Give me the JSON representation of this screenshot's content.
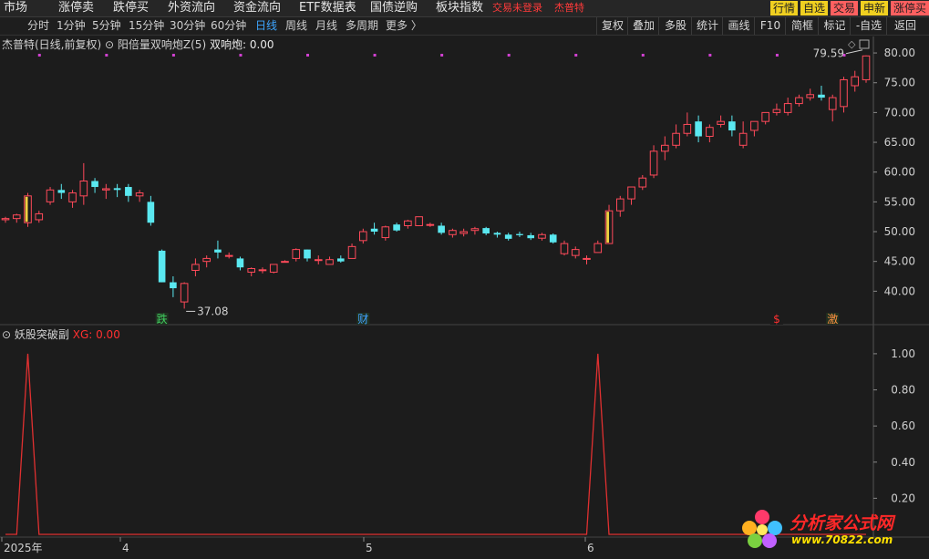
{
  "menu": {
    "items": [
      "市场",
      "涨停卖",
      "跌停买",
      "外资流向",
      "资金流向",
      "ETF数据表",
      "国债逆购",
      "板块指数"
    ],
    "status": "交易未登录",
    "user": "杰普特",
    "right_buttons": [
      {
        "label": "行情",
        "color": "#f0d020"
      },
      {
        "label": "自选",
        "color": "#f0d020"
      },
      {
        "label": "交易",
        "color": "#ff6060"
      },
      {
        "label": "申新",
        "color": "#f0d020"
      },
      {
        "label": "涨停买",
        "color": "#ff6060"
      }
    ]
  },
  "periods": {
    "items": [
      "分时",
      "1分钟",
      "5分钟",
      "15分钟",
      "30分钟",
      "60分钟",
      "日线",
      "周线",
      "月线",
      "多周期",
      "更多 〉"
    ],
    "active": "日线",
    "right_buttons": [
      "复权",
      "叠加",
      "多股",
      "统计",
      "画线",
      "F10",
      "简框",
      "标记",
      "-自选",
      "返回"
    ]
  },
  "main_chart": {
    "stock_title": "杰普特(日线,前复权)",
    "indicator": "阳倍量双响炮Z(5)",
    "indicator_value_label": "双响炮: 0.00",
    "high_label": "79.59",
    "low_label": "37.08",
    "markers": [
      "跌",
      "财",
      "$",
      "激"
    ]
  },
  "sub_chart": {
    "title": "妖股突破副",
    "value_label": "XG: 0.00"
  },
  "x_axis": [
    "2025年",
    "4",
    "5",
    "6"
  ],
  "watermark": {
    "brand": "分析家公式网",
    "url": "www.70822.com"
  },
  "chart_data": [
    {
      "type": "candlestick",
      "title": "杰普特(日线,前复权)",
      "ylim": [
        35,
        82
      ],
      "y_ticks": [
        40.0,
        45.0,
        50.0,
        55.0,
        60.0,
        65.0,
        70.0,
        75.0,
        80.0
      ],
      "x_labels": [
        "2025年",
        "4",
        "5",
        "6"
      ],
      "ohlc": [
        [
          52.0,
          52.5,
          51.5,
          52.2
        ],
        [
          52.2,
          53.0,
          51.5,
          52.8
        ],
        [
          51.5,
          56.5,
          50.8,
          56.0
        ],
        [
          52.0,
          53.5,
          51.5,
          53.0
        ],
        [
          55.0,
          57.5,
          54.5,
          57.0
        ],
        [
          57.0,
          58.0,
          55.5,
          56.5
        ],
        [
          55.0,
          57.0,
          54.0,
          56.5
        ],
        [
          56.0,
          61.5,
          54.5,
          58.5
        ],
        [
          58.5,
          59.0,
          56.5,
          57.5
        ],
        [
          57.0,
          58.0,
          55.5,
          57.2
        ],
        [
          57.3,
          58.0,
          55.8,
          57.0
        ],
        [
          57.5,
          58.0,
          55.0,
          56.0
        ],
        [
          56.0,
          57.0,
          55.0,
          56.5
        ],
        [
          55.0,
          56.0,
          51.0,
          51.5
        ],
        [
          46.8,
          47.0,
          41.5,
          41.5
        ],
        [
          41.5,
          42.5,
          39.0,
          40.5
        ],
        [
          38.2,
          41.5,
          37.08,
          41.3
        ],
        [
          43.5,
          45.5,
          42.5,
          44.5
        ],
        [
          45.0,
          46.0,
          44.0,
          45.5
        ],
        [
          47.0,
          48.5,
          45.5,
          46.5
        ],
        [
          46.0,
          46.5,
          45.5,
          46.0
        ],
        [
          45.5,
          45.8,
          43.5,
          44.0
        ],
        [
          43.2,
          44.0,
          42.5,
          43.8
        ],
        [
          43.5,
          44.0,
          43.0,
          43.6
        ],
        [
          43.2,
          44.5,
          43.0,
          44.5
        ],
        [
          45.0,
          45.2,
          44.8,
          45.0
        ],
        [
          45.5,
          47.2,
          45.0,
          47.0
        ],
        [
          47.0,
          47.0,
          45.0,
          45.5
        ],
        [
          45.2,
          46.0,
          44.5,
          45.3
        ],
        [
          44.5,
          45.8,
          44.5,
          45.3
        ],
        [
          45.5,
          46.0,
          44.8,
          45.0
        ],
        [
          45.5,
          48.0,
          45.5,
          47.5
        ],
        [
          48.5,
          50.5,
          48.0,
          50.0
        ],
        [
          50.5,
          51.5,
          49.5,
          50.0
        ],
        [
          49.0,
          51.0,
          48.5,
          50.8
        ],
        [
          51.2,
          51.5,
          50.0,
          50.2
        ],
        [
          51.0,
          52.0,
          50.5,
          51.8
        ],
        [
          51.0,
          52.5,
          51.0,
          52.5
        ],
        [
          51.2,
          51.5,
          50.8,
          51.2
        ],
        [
          51.0,
          51.5,
          49.5,
          49.8
        ],
        [
          49.5,
          50.5,
          49.0,
          50.2
        ],
        [
          49.7,
          50.5,
          49.2,
          50.0
        ],
        [
          50.2,
          50.8,
          49.5,
          50.5
        ],
        [
          50.6,
          50.8,
          49.4,
          49.7
        ],
        [
          49.8,
          50.0,
          49.0,
          49.5
        ],
        [
          49.5,
          49.8,
          48.5,
          48.8
        ],
        [
          49.6,
          50.0,
          49.1,
          49.4
        ],
        [
          49.4,
          49.8,
          48.6,
          48.9
        ],
        [
          48.9,
          49.8,
          48.5,
          49.5
        ],
        [
          49.5,
          49.7,
          48.0,
          48.2
        ],
        [
          46.3,
          48.5,
          46.0,
          48.0
        ],
        [
          46.0,
          47.5,
          45.5,
          47.0
        ],
        [
          45.5,
          46.0,
          44.5,
          45.5
        ],
        [
          46.5,
          48.5,
          46.5,
          48.0
        ],
        [
          48.0,
          54.5,
          48.0,
          53.5
        ],
        [
          53.5,
          56.0,
          52.5,
          55.5
        ],
        [
          55.5,
          57.5,
          54.5,
          57.5
        ],
        [
          57.5,
          59.5,
          57.0,
          59.0
        ],
        [
          59.5,
          64.5,
          59.0,
          63.5
        ],
        [
          63.5,
          66.0,
          62.0,
          64.5
        ],
        [
          64.5,
          68.0,
          64.0,
          66.5
        ],
        [
          66.5,
          70.0,
          66.0,
          68.0
        ],
        [
          68.5,
          69.5,
          65.0,
          66.0
        ],
        [
          66.0,
          68.0,
          65.0,
          67.5
        ],
        [
          68.0,
          69.5,
          67.5,
          68.5
        ],
        [
          68.5,
          69.5,
          66.0,
          67.0
        ],
        [
          64.5,
          68.5,
          64.0,
          66.5
        ],
        [
          67.0,
          68.5,
          66.0,
          68.5
        ],
        [
          68.5,
          70.0,
          68.0,
          70.0
        ],
        [
          70.0,
          71.5,
          69.5,
          70.5
        ],
        [
          70.0,
          72.5,
          69.5,
          71.5
        ],
        [
          71.5,
          73.0,
          71.0,
          72.5
        ],
        [
          72.5,
          74.0,
          72.0,
          73.0
        ],
        [
          73.0,
          74.5,
          72.0,
          72.5
        ],
        [
          70.5,
          73.0,
          68.5,
          72.5
        ],
        [
          71.0,
          76.0,
          70.0,
          75.5
        ],
        [
          74.5,
          77.0,
          73.5,
          76.0
        ],
        [
          75.5,
          79.59,
          75.0,
          79.5
        ]
      ],
      "markers": [
        {
          "index": 14,
          "label": "跌"
        },
        {
          "index": 32,
          "label": "财"
        },
        {
          "index": 69,
          "label": "$"
        },
        {
          "index": 74,
          "label": "激"
        }
      ],
      "annotations": [
        {
          "index": 16,
          "value": 37.08,
          "label": "37.08"
        },
        {
          "index": 77,
          "value": 79.59,
          "label": "79.59"
        }
      ]
    },
    {
      "type": "line",
      "title": "妖股突破副",
      "series": [
        {
          "name": "XG",
          "values": [
            0,
            0,
            1,
            0,
            0,
            0,
            0,
            0,
            0,
            0,
            0,
            0,
            0,
            0,
            0,
            0,
            0,
            0,
            0,
            0,
            0,
            0,
            0,
            0,
            0,
            0,
            0,
            0,
            0,
            0,
            0,
            0,
            0,
            0,
            0,
            0,
            0,
            0,
            0,
            0,
            0,
            0,
            0,
            0,
            0,
            0,
            0,
            0,
            0,
            0,
            0,
            0,
            0,
            1,
            0,
            0,
            0,
            0,
            0,
            0,
            0,
            0,
            0,
            0,
            0,
            0,
            0,
            0,
            0,
            0,
            0,
            0,
            0,
            0,
            0,
            0,
            0,
            0
          ]
        }
      ],
      "ylim": [
        0,
        1.05
      ],
      "y_ticks": [
        0.2,
        0.4,
        0.6,
        0.8,
        1.0
      ]
    }
  ],
  "colors": {
    "up": "#ff4a5a",
    "down": "#5ae8f0",
    "limit": "#f0d040",
    "xg_line": "#e03030",
    "dots": "#d040d0"
  }
}
